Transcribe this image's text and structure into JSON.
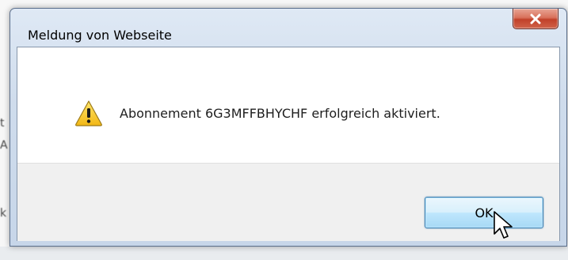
{
  "dialog": {
    "title": "Meldung von Webseite",
    "message": "Abonnement 6G3MFFBHYCHF erfolgreich aktiviert.",
    "ok_label": "OK",
    "icon": "warning-icon"
  },
  "colors": {
    "titlebar": "#cfdcec",
    "close_button": "#c1412a",
    "ok_button_border": "#3c7fb1",
    "footer": "#f0f0f0"
  }
}
